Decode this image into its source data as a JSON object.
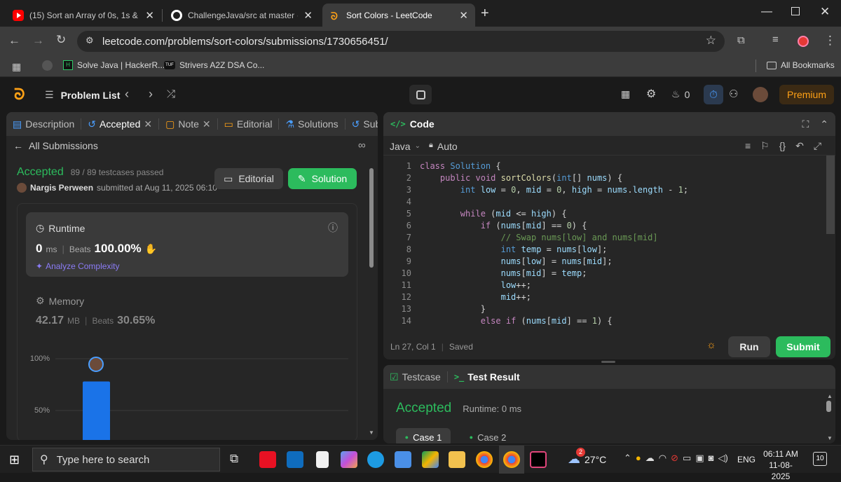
{
  "browser": {
    "tabs": [
      {
        "title": "(15) Sort an Array of 0s, 1s & 2s",
        "active": false,
        "favicon": "youtube-icon"
      },
      {
        "title": "ChallengeJava/src at master · N",
        "active": false,
        "favicon": "github-icon"
      },
      {
        "title": "Sort Colors - LeetCode",
        "active": true,
        "favicon": "leetcode-icon"
      }
    ],
    "url": "leetcode.com/problems/sort-colors/submissions/1730656451/",
    "bookmarks": [
      {
        "label": "Solve Java | HackerR..."
      },
      {
        "label": "Strivers A2Z DSA Co..."
      }
    ],
    "all_bookmarks": "All Bookmarks"
  },
  "lc_header": {
    "problem_list": "Problem List",
    "streak": "0",
    "premium": "Premium"
  },
  "left_panel": {
    "tabs": [
      {
        "label": "Description",
        "icon": "description-icon"
      },
      {
        "label": "Accepted",
        "icon": "history-icon"
      },
      {
        "label": "Note",
        "icon": "note-icon"
      },
      {
        "label": "Editorial",
        "icon": "book-icon"
      },
      {
        "label": "Solutions",
        "icon": "flask-icon"
      },
      {
        "label": "Sub",
        "icon": "history-icon"
      }
    ],
    "all_submissions": "All Submissions",
    "status": "Accepted",
    "testcases": "89 / 89 testcases passed",
    "author": "Nargis Perween",
    "submitted_at": "submitted at Aug 11, 2025 06:10",
    "editorial_btn": "Editorial",
    "solution_btn": "Solution",
    "runtime": {
      "label": "Runtime",
      "value": "0",
      "unit": "ms",
      "beats_label": "Beats",
      "beats_value": "100.00%",
      "analyze": "Analyze Complexity"
    },
    "memory": {
      "label": "Memory",
      "value": "42.17",
      "unit": "MB",
      "beats_label": "Beats",
      "beats_value": "30.65%"
    },
    "chart_data": {
      "type": "bar",
      "y_ticks": [
        "100%",
        "50%"
      ],
      "values": [
        78
      ],
      "ylim": [
        0,
        100
      ]
    }
  },
  "code_panel": {
    "title": "Code",
    "language": "Java",
    "auto": "Auto",
    "lines": [
      "class Solution {",
      "    public void sortColors(int[] nums) {",
      "        int low = 0, mid = 0, high = nums.length - 1;",
      "",
      "        while (mid <= high) {",
      "            if (nums[mid] == 0) {",
      "                // Swap nums[low] and nums[mid]",
      "                int temp = nums[low];",
      "                nums[low] = nums[mid];",
      "                nums[mid] = temp;",
      "                low++;",
      "                mid++;",
      "            }",
      "            else if (nums[mid] == 1) {"
    ],
    "cursor": "Ln 27, Col 1",
    "saved": "Saved",
    "run": "Run",
    "submit": "Submit"
  },
  "test_panel": {
    "testcase_tab": "Testcase",
    "result_tab": "Test Result",
    "status": "Accepted",
    "runtime": "Runtime: 0 ms",
    "cases": [
      "Case 1",
      "Case 2"
    ]
  },
  "taskbar": {
    "search_placeholder": "Type here to search",
    "weather": "27°C",
    "lang": "ENG",
    "time": "06:11 AM",
    "date": "11-08-2025",
    "notifications": "10",
    "weather_badge": "2"
  },
  "colors": {
    "accent_green": "#2cbb5d",
    "premium_orange": "#ffa116",
    "bar_blue": "#1a73e8"
  }
}
